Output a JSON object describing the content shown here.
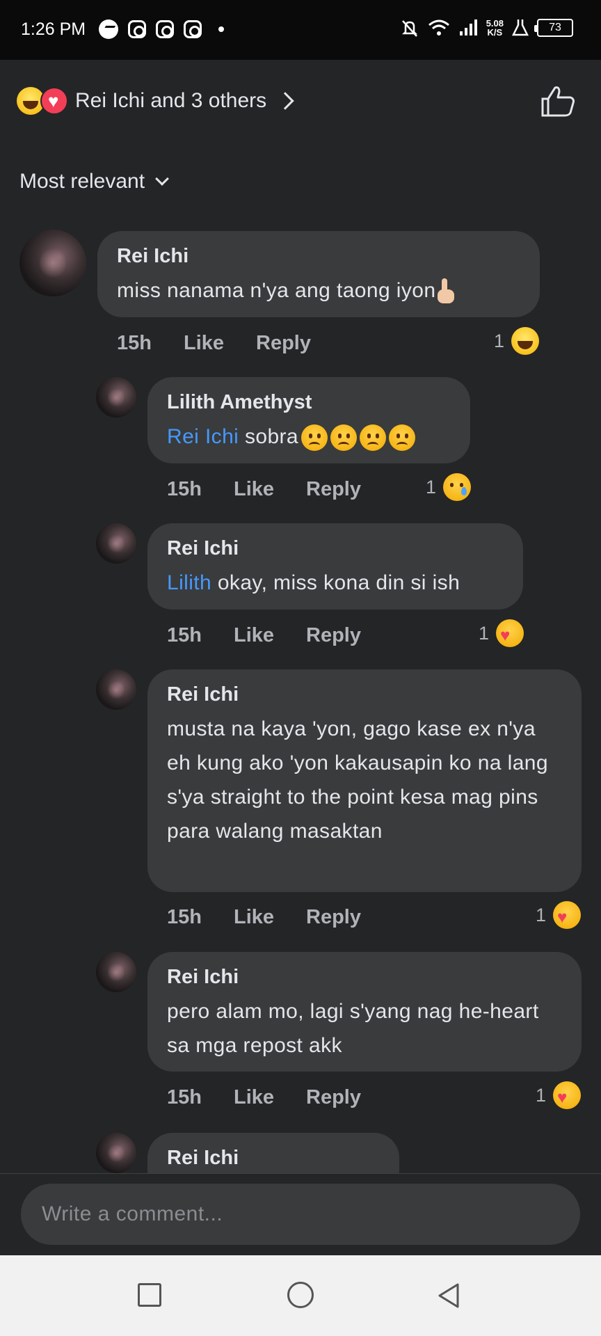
{
  "status_bar": {
    "time": "1:26 PM",
    "speed_value": "5.08",
    "speed_unit": "K/S",
    "battery": "73"
  },
  "reactions": {
    "summary": "Rei Ichi and 3 others",
    "icons": [
      "laugh-emoji",
      "heart-emoji"
    ]
  },
  "sort": {
    "label": "Most relevant"
  },
  "comments": [
    {
      "author": "Rei Ichi",
      "text": "miss nanama n'ya ang taong iyon",
      "trailing_emoji": "pointing-up-emoji",
      "time": "15h",
      "like": "Like",
      "reply": "Reply",
      "reaction_count": "1",
      "reaction_icon": "laugh-emoji"
    },
    {
      "author": "Lilith Amethyst",
      "mention": "Rei Ichi",
      "text": " sobra",
      "trailing_emoji": "frowning-emoji x4",
      "time": "15h",
      "like": "Like",
      "reply": "Reply",
      "reaction_count": "1",
      "reaction_icon": "sad-emoji"
    },
    {
      "author": "Rei Ichi",
      "mention": "Lilith",
      "text": " okay, miss kona din si ish",
      "time": "15h",
      "like": "Like",
      "reply": "Reply",
      "reaction_count": "1",
      "reaction_icon": "care-emoji"
    },
    {
      "author": "Rei Ichi",
      "text": "musta na kaya 'yon, gago kase ex n'ya eh kung ako 'yon kakausapin ko na lang s'ya straight to the point kesa mag pins para walang masaktan",
      "time": "15h",
      "like": "Like",
      "reply": "Reply",
      "reaction_count": "1",
      "reaction_icon": "care-emoji"
    },
    {
      "author": "Rei Ichi",
      "text": "pero alam mo, lagi s'yang nag he-heart sa mga repost akk",
      "time": "15h",
      "like": "Like",
      "reply": "Reply",
      "reaction_count": "1",
      "reaction_icon": "care-emoji"
    },
    {
      "author": "Rei Ichi"
    }
  ],
  "composer": {
    "placeholder": "Write a comment..."
  },
  "colors": {
    "background": "#242526",
    "bubble": "#3a3b3c",
    "mention": "#4599ff",
    "muted": "#b0b3b8"
  }
}
